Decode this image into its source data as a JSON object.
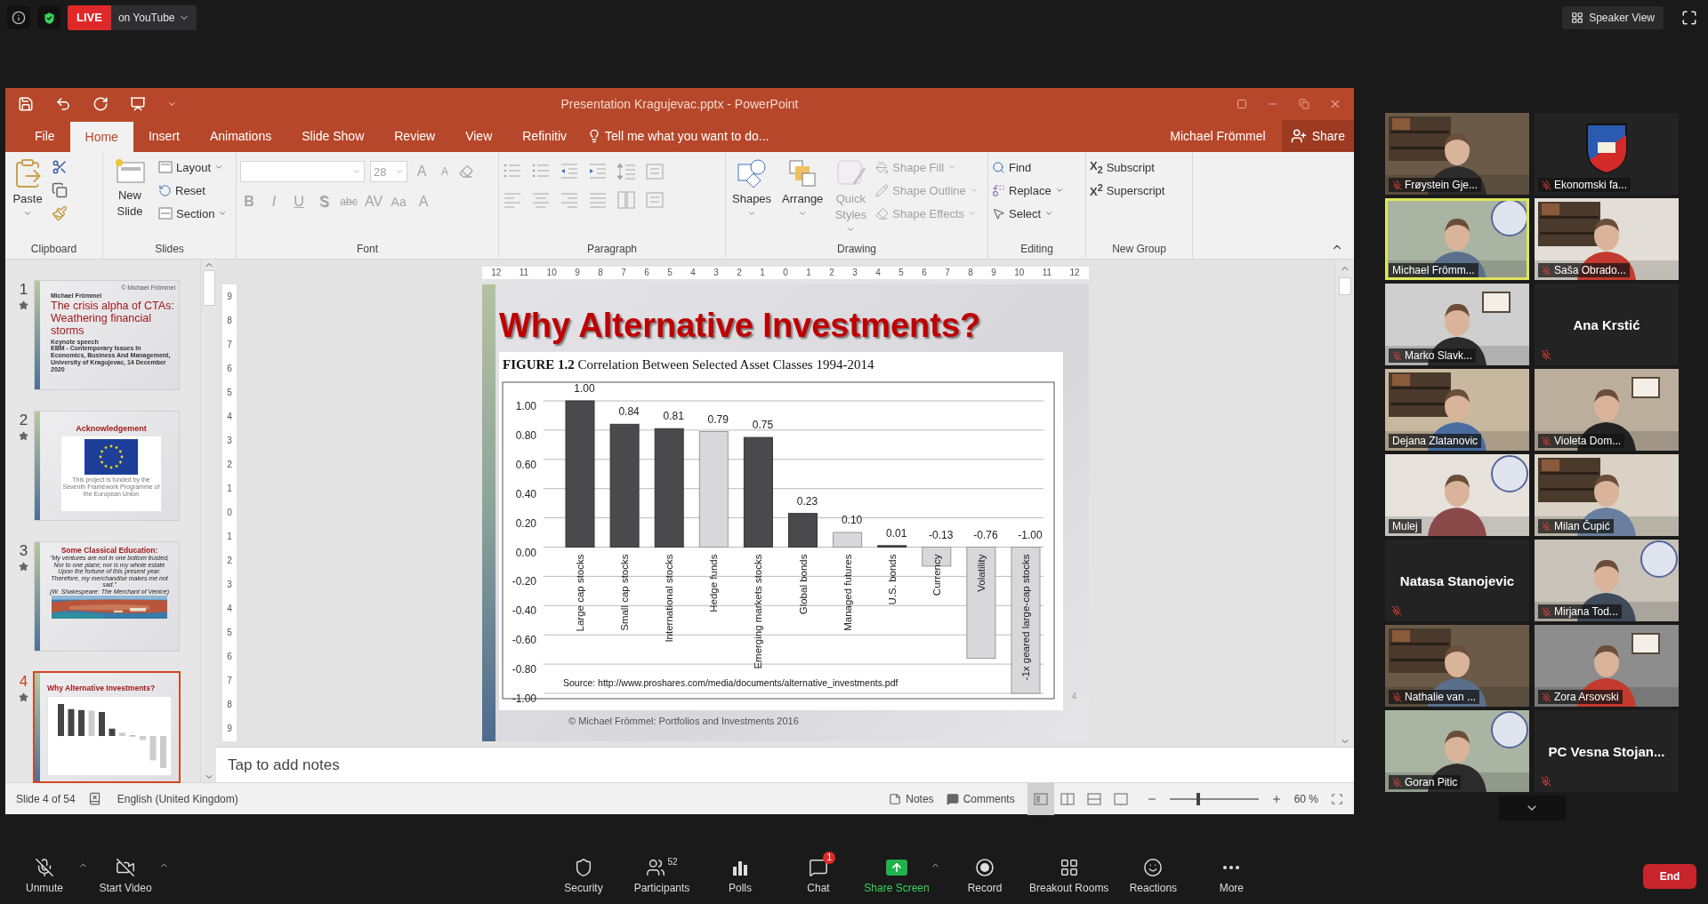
{
  "top_bar": {
    "live_badge": "LIVE",
    "live_target": "on YouTube",
    "view_button": "Speaker View"
  },
  "powerpoint": {
    "title": "Presentation Kragujevac.pptx - PowerPoint",
    "tabs": [
      {
        "label": "File",
        "selected": false
      },
      {
        "label": "Home",
        "selected": true
      },
      {
        "label": "Insert",
        "selected": false
      },
      {
        "label": "Animations",
        "selected": false
      },
      {
        "label": "Slide Show",
        "selected": false
      },
      {
        "label": "Review",
        "selected": false
      },
      {
        "label": "View",
        "selected": false
      },
      {
        "label": "Refinitiv",
        "selected": false
      }
    ],
    "tell_me": "Tell me what you want to do...",
    "user": "Michael Frömmel",
    "share": "Share",
    "ribbon": {
      "clipboard": {
        "label": "Clipboard",
        "paste": "Paste"
      },
      "slides": {
        "label": "Slides",
        "new_slide": "New Slide",
        "items": [
          {
            "label": "Layout",
            "dropdown": true
          },
          {
            "label": "Reset",
            "dropdown": false
          },
          {
            "label": "Section",
            "dropdown": true
          }
        ]
      },
      "font": {
        "label": "Font",
        "disabled": true,
        "font_size": "28",
        "grow": "A",
        "shrink": "A",
        "styles": [
          "B",
          "I",
          "U",
          "S",
          "abc",
          "AV",
          "Aa",
          "A"
        ]
      },
      "paragraph": {
        "label": "Paragraph",
        "disabled": true
      },
      "drawing": {
        "label": "Drawing",
        "big": [
          {
            "label": "Shapes",
            "disabled": false
          },
          {
            "label": "Arrange",
            "disabled": false
          },
          {
            "label": "Quick Styles",
            "disabled": true
          }
        ],
        "small": [
          {
            "label": "Shape Fill",
            "disabled": true
          },
          {
            "label": "Shape Outline",
            "disabled": true
          },
          {
            "label": "Shape Effects",
            "disabled": true
          }
        ]
      },
      "editing": {
        "label": "Editing",
        "items": [
          {
            "label": "Find",
            "dropdown": false
          },
          {
            "label": "Replace",
            "dropdown": true
          },
          {
            "label": "Select",
            "dropdown": true
          }
        ]
      },
      "new_group": {
        "label": "New Group",
        "items": [
          {
            "glyph": "X$_{2}$",
            "label": "Subscript"
          },
          {
            "glyph": "X$^{2}$",
            "label": "Superscript"
          }
        ]
      }
    },
    "slides": [
      {
        "number": "1",
        "selected": false,
        "kind": "title",
        "top_note": "© Michael Frömmel",
        "author": "Michael Frömmel",
        "title": "The crisis alpha of CTAs: Weathering financial storms",
        "subtitle": "Keynote speech",
        "details": "EBM - Contemporary Issues In Economics, Business And Management, University of Kragujevac, 14 December 2020"
      },
      {
        "number": "2",
        "selected": false,
        "kind": "flag",
        "title": "Acknowledgement",
        "caption": "This project is funded by the Seventh Framework Programme of the European Union"
      },
      {
        "number": "3",
        "selected": false,
        "kind": "quote",
        "title": "Some Classical Education:",
        "quote_lines": [
          "\"My ventures are not in one bottom trusted,",
          "Nor to one place; nor is my whole estate",
          "Upon the fortune of this present year:",
          "Therefore, my merchandise makes me not sad.\"",
          "(W. Shakespeare: The Merchant of Venice)"
        ]
      },
      {
        "number": "4",
        "selected": true,
        "kind": "chart",
        "title": "Why Alternative Investments?"
      }
    ],
    "horizontal_ruler": [
      "12",
      "11",
      "10",
      "9",
      "8",
      "7",
      "6",
      "5",
      "4",
      "3",
      "2",
      "1",
      "0",
      "1",
      "2",
      "3",
      "4",
      "5",
      "6",
      "7",
      "8",
      "9",
      "10",
      "11",
      "12"
    ],
    "vertical_ruler": [
      "9",
      "8",
      "7",
      "6",
      "5",
      "4",
      "3",
      "2",
      "1",
      "0",
      "1",
      "2",
      "3",
      "4",
      "5",
      "6",
      "7",
      "8",
      "9"
    ],
    "slide": {
      "title": "Why Alternative Investments?",
      "chart_data": {
        "type": "bar",
        "title": "**FIGURE 1.2** Correlation Between Selected Asset Classes 1994-2014",
        "categories": [
          "Large cap stocks",
          "Small cap stocks",
          "International stocks",
          "Hedge funds",
          "Emerging markets stocks",
          "Global bonds",
          "Managed futures",
          "U.S. bonds",
          "Currency",
          "Volatility",
          "-1x geared large-cap stocks"
        ],
        "series": [
          {
            "color": "#4a4a4c",
            "values": [
              1.0,
              0.84,
              0.81,
              null,
              0.75,
              0.23,
              null,
              0.01,
              null,
              null,
              null
            ]
          },
          {
            "color": "#d8d8da",
            "values": [
              null,
              null,
              null,
              0.79,
              null,
              null,
              0.1,
              null,
              -0.13,
              -0.76,
              -1.0
            ]
          }
        ],
        "stacked": true,
        "ylim": [
          -1,
          1
        ],
        "yticks": [
          {
            "value": 1,
            "label": "1.00"
          },
          {
            "value": 0.8,
            "label": "0.80"
          },
          {
            "value": 0.6,
            "label": "0.60"
          },
          {
            "value": 0.4,
            "label": "0.40"
          },
          {
            "value": 0.2,
            "label": "0.20"
          },
          {
            "value": 0,
            "label": "0.00"
          },
          {
            "value": -0.2,
            "label": "-0.20"
          },
          {
            "value": -0.4,
            "label": "-0.40"
          },
          {
            "value": -0.6,
            "label": "-0.60"
          },
          {
            "value": -0.8,
            "label": "-0.80"
          },
          {
            "value": -1,
            "label": "-1.00"
          }
        ],
        "grid": true,
        "value_labels": [
          "1.00",
          "0.84",
          "0.81",
          "0.79",
          "0.75",
          "0.23",
          "0.10",
          "0.01",
          "-0.13",
          "-0.76",
          "-1.00"
        ],
        "annotations": [
          "Source: http://www.proshares.com/media/documents/alternative_investments.pdf"
        ]
      },
      "footer": "© Michael Frömmel: Portfolios and Investments 2016",
      "page_number": "4"
    },
    "notes_placeholder": "Tap to add notes",
    "status_bar": {
      "slide_info": "Slide 4 of 54",
      "language": "English (United Kingdom)",
      "notes": "Notes",
      "comments": "Comments",
      "views": [
        {
          "selected": true
        },
        {
          "selected": false
        },
        {
          "selected": false
        },
        {
          "selected": false
        }
      ],
      "zoom": {
        "level": 0.3,
        "reading": "60 %"
      }
    }
  },
  "participants": [
    {
      "name": "Frøystein Gje...",
      "kind": "video",
      "muted": true,
      "speaking": false
    },
    {
      "name": "Ekonomski fa...",
      "kind": "logo",
      "muted": true,
      "speaking": false
    },
    {
      "name": "Michael Frömm...",
      "kind": "video",
      "muted": false,
      "speaking": true
    },
    {
      "name": "Saša Obrado...",
      "kind": "video",
      "muted": true,
      "speaking": false
    },
    {
      "name": "Marko Slavk...",
      "kind": "video",
      "muted": true,
      "speaking": false
    },
    {
      "name": "Ana Krstić",
      "kind": "name",
      "muted": true,
      "speaking": false
    },
    {
      "name": "Dejana Zlatanovic",
      "kind": "video",
      "muted": false,
      "speaking": false
    },
    {
      "name": "Violeta Dom...",
      "kind": "video",
      "muted": true,
      "speaking": false
    },
    {
      "name": "Mulej",
      "kind": "video",
      "muted": false,
      "speaking": false
    },
    {
      "name": "Milan Čupić",
      "kind": "video",
      "muted": true,
      "speaking": false
    },
    {
      "name": "Natasa Stanojevic",
      "kind": "name",
      "muted": true,
      "speaking": false
    },
    {
      "name": "Mirjana Tod...",
      "kind": "video",
      "muted": true,
      "speaking": false
    },
    {
      "name": "Nathalie van ...",
      "kind": "video",
      "muted": true,
      "speaking": false
    },
    {
      "name": "Zora Arsovski",
      "kind": "video",
      "muted": true,
      "speaking": false
    },
    {
      "name": "Goran Pitic",
      "kind": "video",
      "muted": true,
      "speaking": false
    },
    {
      "name": "PC Vesna Stojan...",
      "kind": "name",
      "muted": true,
      "speaking": false
    }
  ],
  "meeting_controls": {
    "left": [
      {
        "label": "Unmute",
        "kind": "mic"
      },
      {
        "label": "Start Video",
        "kind": "video"
      }
    ],
    "center": [
      {
        "label": "Security",
        "kind": "security"
      },
      {
        "label": "Participants",
        "kind": "participants",
        "count": "52"
      },
      {
        "label": "Polls",
        "kind": "polls"
      },
      {
        "label": "Chat",
        "kind": "chat",
        "badge": "1"
      },
      {
        "label": "Share Screen",
        "kind": "share"
      },
      {
        "label": "Record",
        "kind": "record"
      },
      {
        "label": "Breakout Rooms",
        "kind": "breakout"
      },
      {
        "label": "Reactions",
        "kind": "reactions"
      },
      {
        "label": "More",
        "kind": "more"
      }
    ],
    "end": "End"
  }
}
